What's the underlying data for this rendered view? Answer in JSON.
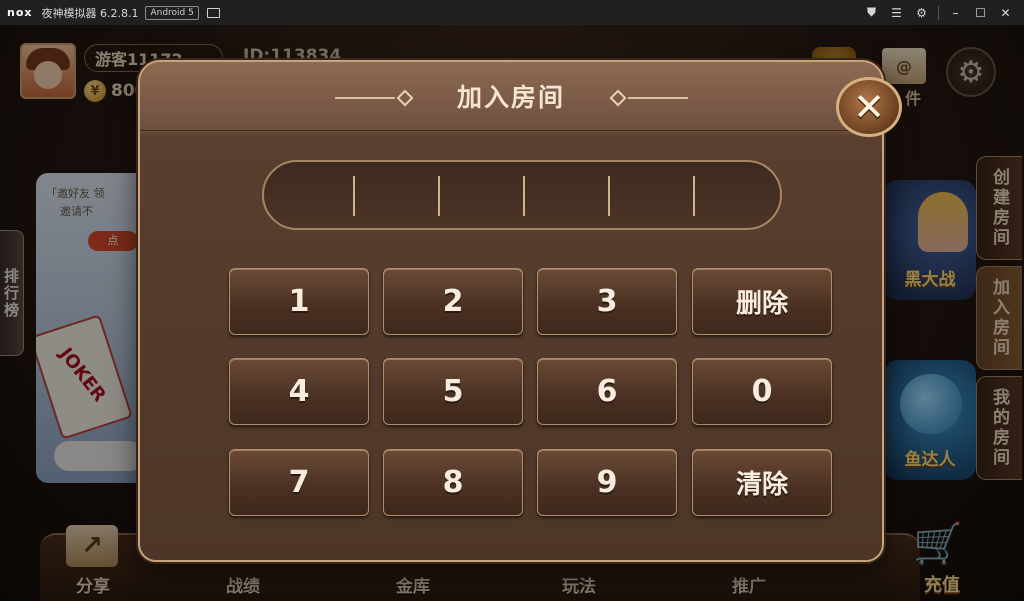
{
  "emulator": {
    "logo": "nox",
    "app_name": "夜神模拟器 6.2.8.1",
    "android_badge": "Android 5"
  },
  "player": {
    "name": "游客11172",
    "id_label": "ID:113834",
    "coins": "800"
  },
  "top_right": {
    "mail_label": "件"
  },
  "left": {
    "leaderboard_label": "排行榜",
    "promo_line1": "「邀好友 领",
    "promo_line2": "邀请不",
    "promo_button": "点",
    "promo_card": "JOKER"
  },
  "right_tabs": [
    {
      "label": "创建房间"
    },
    {
      "label": "加入房间"
    },
    {
      "label": "我的房间"
    }
  ],
  "game_cards": [
    {
      "title": "黑大战"
    },
    {
      "title": "鱼达人"
    }
  ],
  "bottom_nav": [
    {
      "label": "分享"
    },
    {
      "label": "战绩"
    },
    {
      "label": "金库"
    },
    {
      "label": "玩法"
    },
    {
      "label": "推广"
    },
    {
      "label": "充值"
    }
  ],
  "dialog": {
    "title": "加入房间",
    "close_symbol": "✕",
    "code_value": "",
    "keys": [
      "1",
      "2",
      "3",
      "删除",
      "4",
      "5",
      "6",
      "0",
      "7",
      "8",
      "9",
      "清除"
    ]
  }
}
